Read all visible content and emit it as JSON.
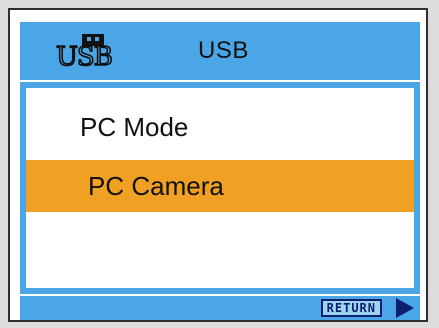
{
  "header": {
    "icon": "usb-icon",
    "title": "USB"
  },
  "menu": {
    "items": [
      {
        "label": "PC Mode",
        "selected": false
      },
      {
        "label": "PC Camera",
        "selected": true
      }
    ]
  },
  "footer": {
    "return_label": "RETURN",
    "arrow_icon": "play-arrow-icon"
  },
  "colors": {
    "accent": "#4aa6e6",
    "selection": "#f0a023",
    "text": "#111111"
  }
}
